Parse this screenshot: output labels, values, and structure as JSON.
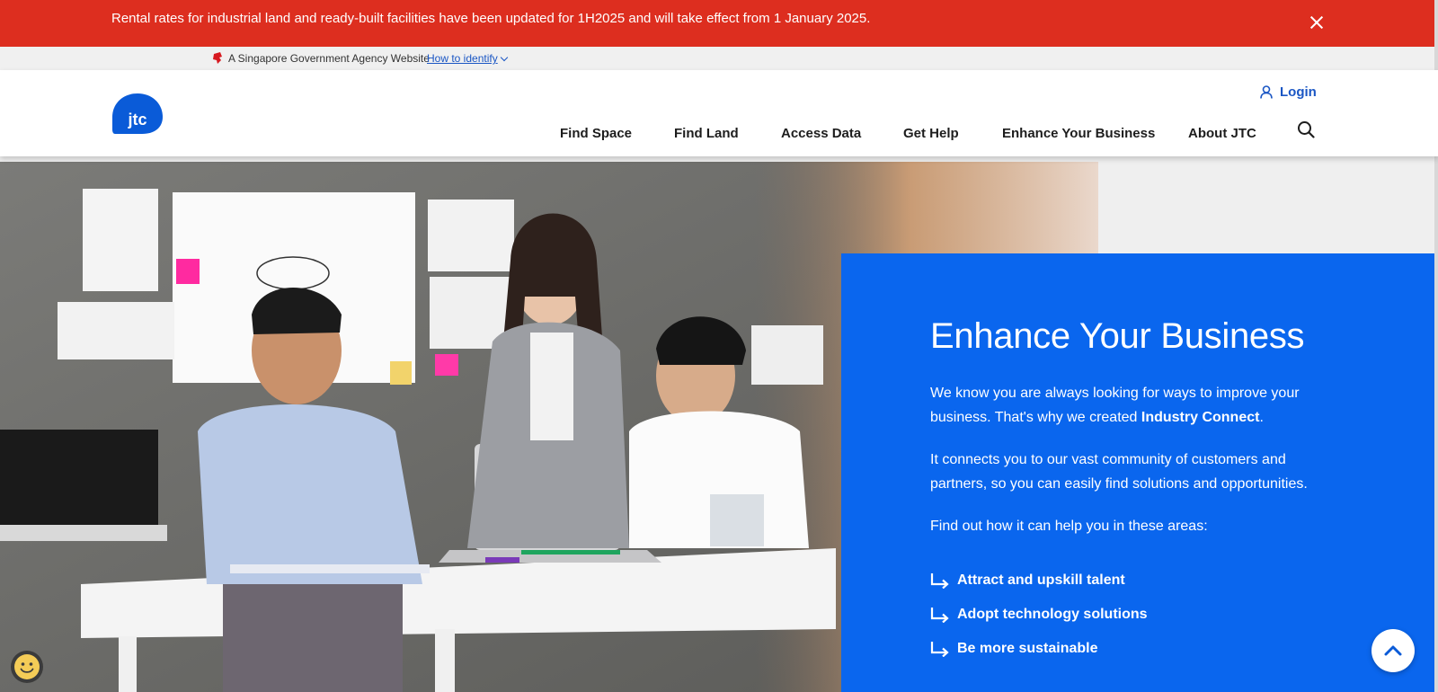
{
  "alert": {
    "message": "Rental rates for industrial land and ready-built facilities have been updated for 1H2025 and will take effect from 1 January 2025.",
    "background_color": "#dd2e1f"
  },
  "gov_bar": {
    "text": "A Singapore Government Agency Website",
    "link": "How to identify"
  },
  "header": {
    "logo_text": "jtc",
    "login_label": "Login",
    "nav": [
      {
        "label": "Find Space"
      },
      {
        "label": "Find Land"
      },
      {
        "label": "Access Data"
      },
      {
        "label": "Get Help"
      },
      {
        "label": "Enhance Your Business"
      },
      {
        "label": "About JTC"
      }
    ],
    "brand_color": "#1a56c4"
  },
  "hero": {
    "title": "Enhance Your Business",
    "p1_before": "We know you are always looking for ways to improve your business. That's why we created ",
    "p1_strong": "Industry Connect",
    "p1_after": ".",
    "p2": "It connects you to our vast community of customers and partners, so you can easily find solutions and opportunities.",
    "p3": "Find out how it can help you in these areas:",
    "links": [
      {
        "label": "Attract and upskill talent"
      },
      {
        "label": "Adopt technology solutions"
      },
      {
        "label": "Be more sustainable"
      }
    ],
    "panel_color": "#0a66ee"
  },
  "icons": {
    "close": "close-icon",
    "user": "user-icon",
    "search": "search-icon",
    "arrow": "corner-down-right-arrow-icon",
    "back_to_top": "chevron-up-icon",
    "feedback": "smiley-icon"
  }
}
